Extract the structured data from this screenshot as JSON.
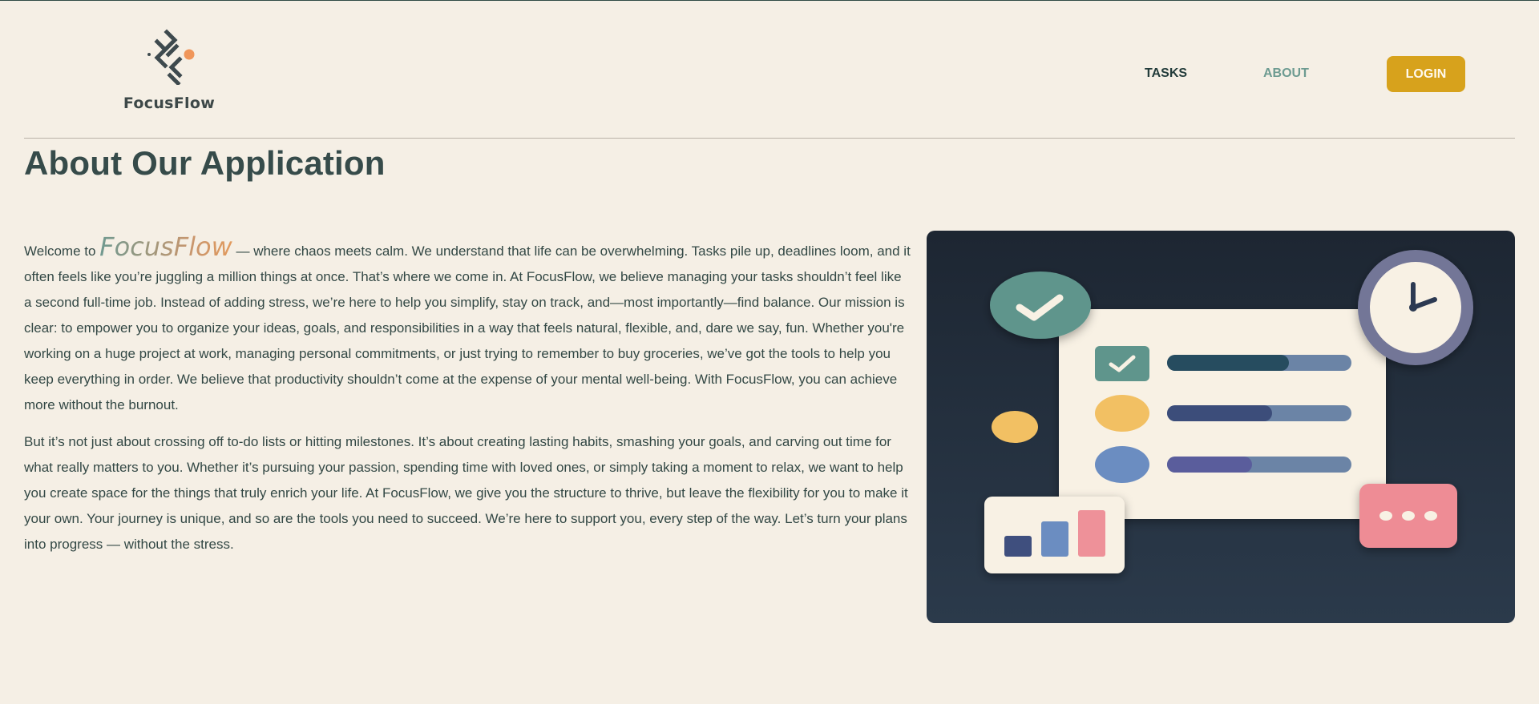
{
  "header": {
    "brand": "FocusFlow",
    "nav": {
      "tasks": "TASKS",
      "about": "ABOUT"
    },
    "login_label": "LOGIN"
  },
  "page": {
    "title": "About Our Application"
  },
  "about": {
    "p1_prefix": "Welcome to ",
    "p1_brand": "FocusFlow",
    "p1_rest": " — where chaos meets calm. We understand that life can be overwhelming. Tasks pile up, deadlines loom, and it often feels like you’re juggling a million things at once. That’s where we come in. At FocusFlow, we believe managing your tasks shouldn’t feel like a second full-time job. Instead of adding stress, we’re here to help you simplify, stay on track, and—most importantly—find balance. Our mission is clear: to empower you to organize your ideas, goals, and responsibilities in a way that feels natural, flexible, and, dare we say, fun. Whether you're working on a huge project at work, managing personal commitments, or just trying to remember to buy groceries, we’ve got the tools to help you keep everything in order. We believe that productivity shouldn’t come at the expense of your mental well-being. With FocusFlow, you can achieve more without the burnout.",
    "p2": "But it’s not just about crossing off to-do lists or hitting milestones. It’s about creating lasting habits, smashing your goals, and carving out time for what really matters to you. Whether it’s pursuing your passion, spending time with loved ones, or simply taking a moment to relax, we want to help you create space for the things that truly enrich your life. At FocusFlow, we give you the structure to thrive, but leave the flexibility for you to make it your own. Your journey is unique, and so are the tools you need to succeed. We’re here to support you, every step of the way. Let’s turn your plans into progress — without the stress."
  },
  "illustration": {
    "progress": [
      0.66,
      0.57,
      0.46
    ],
    "chart_bars": [
      0.45,
      0.75,
      1.0
    ]
  },
  "colors": {
    "background": "#f5efe5",
    "accent_button": "#d7a21c",
    "nav_active": "#6d9b91",
    "text": "#334845"
  }
}
